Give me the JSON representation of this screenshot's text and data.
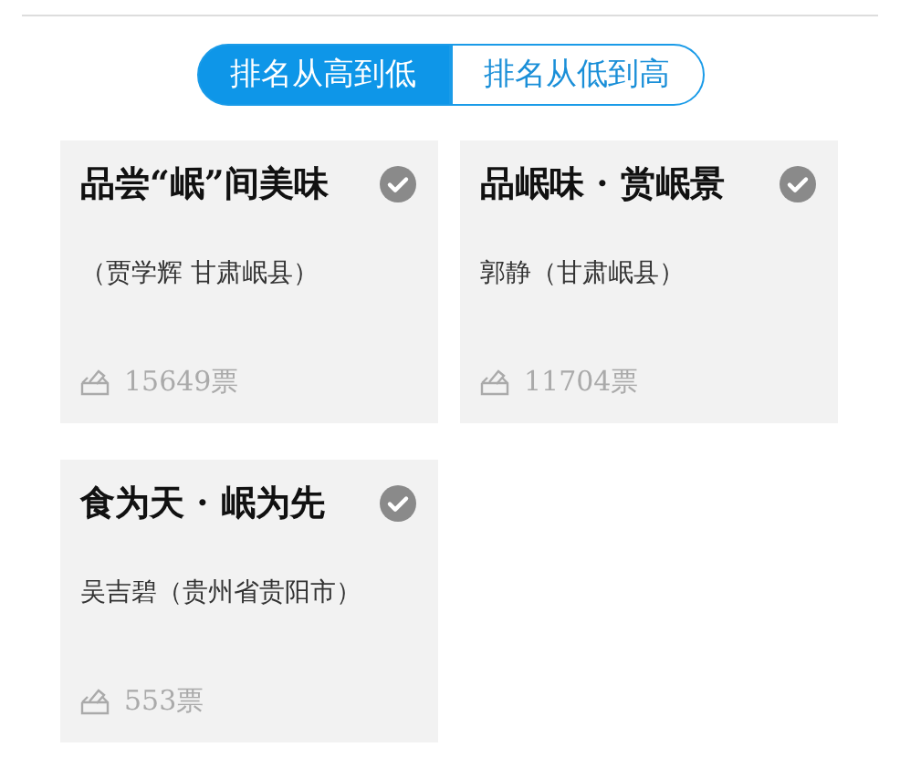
{
  "sort_tabs": [
    {
      "label": "排名从高到低",
      "selected": true
    },
    {
      "label": "排名从低到高",
      "selected": false
    }
  ],
  "entries": [
    {
      "title": "品尝“岷”间美味",
      "checked": true,
      "author": "（贾学辉  甘肃岷县）",
      "votes": "15649票"
    },
    {
      "title": "品岷味 · 赏岷景",
      "checked": true,
      "author": "郭静（甘肃岷县）",
      "votes": "11704票"
    },
    {
      "title": "食为天 · 岷为先",
      "checked": true,
      "author": "吴吉碧（贵州省贵阳市）",
      "votes": "553票"
    }
  ]
}
